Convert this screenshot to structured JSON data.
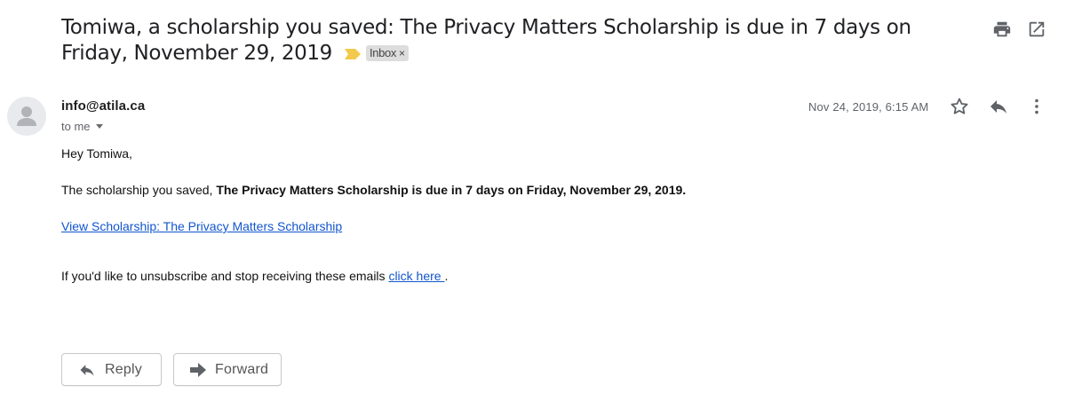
{
  "subject": {
    "text": "Tomiwa, a scholarship you saved: The Privacy Matters Scholarship is due in 7 days on Friday, November 29, 2019",
    "label": "Inbox",
    "label_remove": "×"
  },
  "toolbar_icons": [
    "print-icon",
    "open-in-new-window-icon"
  ],
  "message": {
    "sender": "info@atila.ca",
    "recipient": "to me",
    "date": "Nov 24, 2019, 6:15 AM",
    "header_icons": [
      "star-icon",
      "reply-icon",
      "more-vert-icon"
    ],
    "greeting": "Hey Tomiwa,",
    "para_prefix": "The scholarship you saved, ",
    "para_bold": "The Privacy Matters Scholarship is due in 7 days on Friday, November 29, 2019.",
    "view_link": "View Scholarship: The Privacy Matters Scholarship",
    "unsub_prefix": "If you'd like to unsubscribe and stop receiving these emails ",
    "unsub_link": "click here ",
    "unsub_suffix": "."
  },
  "actions": {
    "reply": "Reply",
    "forward": "Forward"
  },
  "colors": {
    "link": "#1155cc",
    "importance_marker": "#f2c94c",
    "label_bg": "#dddddd"
  }
}
